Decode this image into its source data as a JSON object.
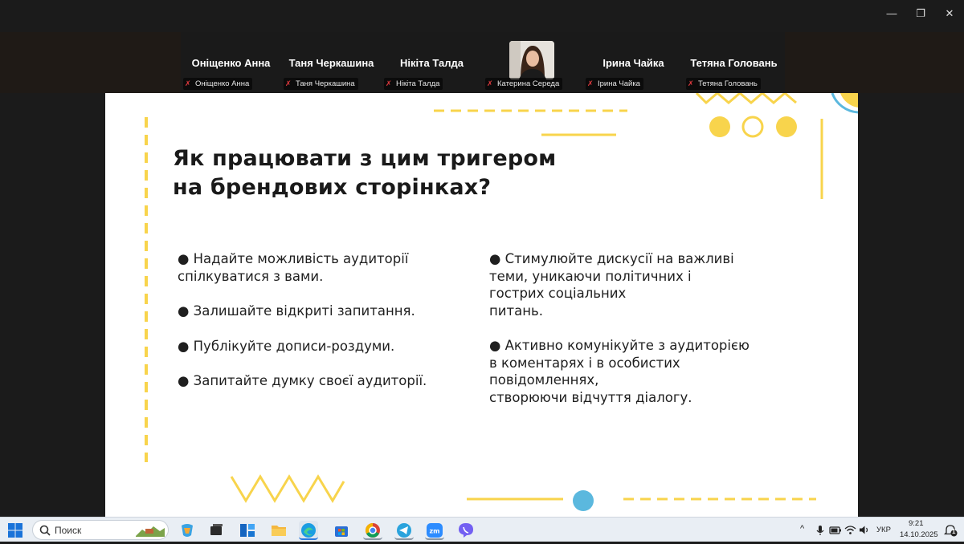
{
  "window": {
    "controls": {
      "minimize": "—",
      "restore": "❐",
      "close": "✕"
    }
  },
  "participants": [
    {
      "name": "Оніщенко Анна",
      "tag": "Оніщенко Анна",
      "muted": true,
      "video": false
    },
    {
      "name": "Таня Черкашина",
      "tag": "Таня Черкашина",
      "muted": true,
      "video": false
    },
    {
      "name": "Нікіта Талда",
      "tag": "Нікіта Талда",
      "muted": true,
      "video": false
    },
    {
      "name": "",
      "tag": "Катерина Середа",
      "muted": true,
      "video": true
    },
    {
      "name": "Ірина Чайка",
      "tag": "Ірина Чайка",
      "muted": true,
      "video": false
    },
    {
      "name": "Тетяна Головань",
      "tag": "Тетяна Головань",
      "muted": true,
      "video": false
    }
  ],
  "slide": {
    "title_line1": "Як працювати з цим тригером",
    "title_line2": "на брендових сторінках?",
    "left_bullets": [
      "● Надайте можливість аудиторії\nспілкуватися з вами.",
      "● Залишайте відкриті запитання.",
      "● Публікуйте дописи-роздуми.",
      "● Запитайте думку своєї аудиторії."
    ],
    "right_bullets": [
      "● Стимулюйте дискусії на важливі\nтеми, уникаючи політичних і\nгострих соціальних\nпитань.",
      "● Активно комунікуйте з аудиторією\nв коментарях і в особистих\nповідомленнях,\nстворюючи відчуття діалогу."
    ],
    "colors": {
      "accent_yellow": "#f8d44c",
      "accent_blue": "#5bb8de"
    }
  },
  "taskbar": {
    "search_placeholder": "Поиск",
    "apps": [
      "start-icon",
      "search-icon",
      "copilot-icon",
      "task-view-icon",
      "widgets-icon",
      "file-explorer-icon",
      "edge-icon",
      "microsoft-store-icon",
      "chrome-icon",
      "telegram-icon",
      "zoom-icon",
      "viber-icon"
    ],
    "language": "УКР",
    "time": "9:21",
    "date": "14.10.2025",
    "notifications": "1"
  }
}
